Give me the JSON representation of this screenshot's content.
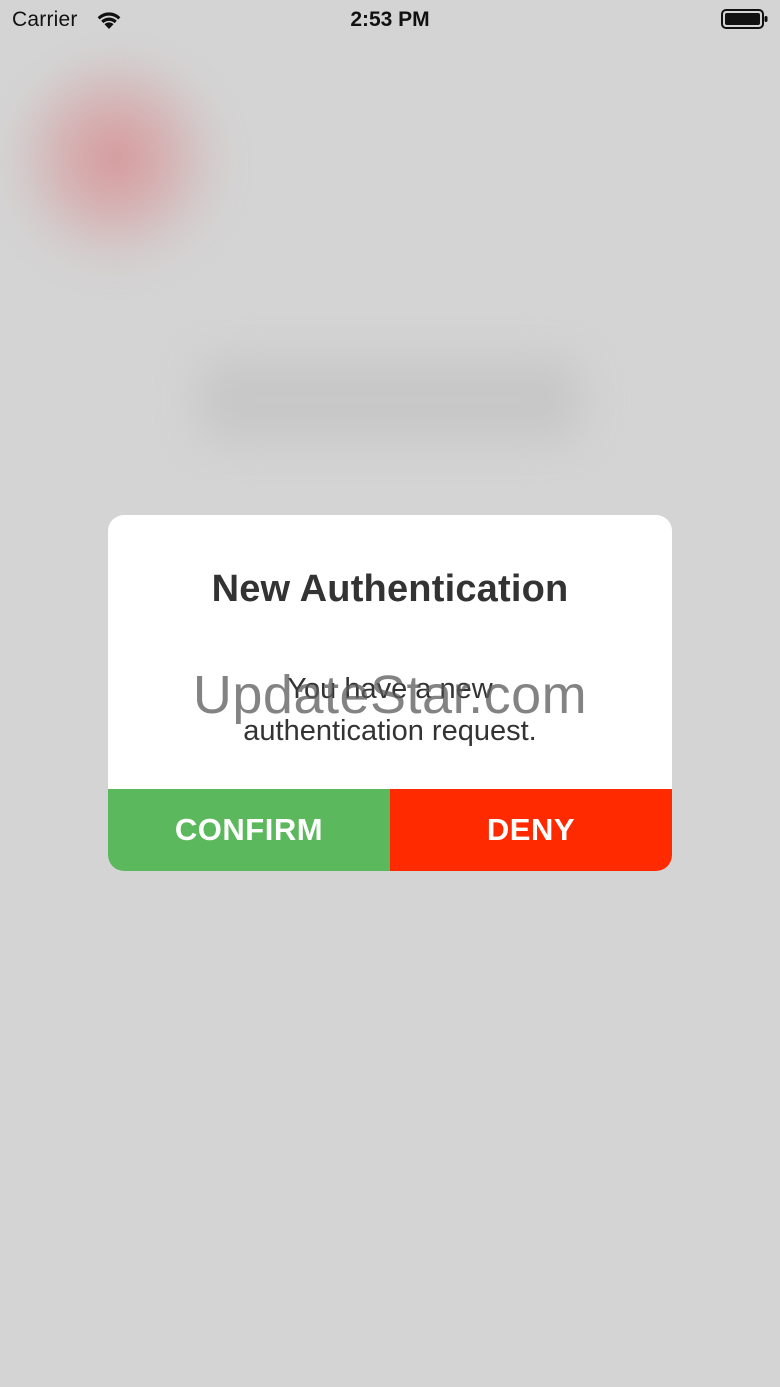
{
  "status_bar": {
    "carrier": "Carrier",
    "time": "2:53 PM",
    "wifi_icon": "wifi-icon",
    "battery_icon": "battery-icon"
  },
  "modal": {
    "title": "New Authentication",
    "message_lines": [
      "You have a new",
      "authentication request."
    ],
    "confirm_label": "CONFIRM",
    "deny_label": "DENY"
  },
  "watermark": "UpdateStar.com",
  "colors": {
    "background": "#d4d4d4",
    "modal_background": "#ffffff",
    "confirm": "#5cb85c",
    "deny": "#ff2a00",
    "text": "#333333"
  }
}
